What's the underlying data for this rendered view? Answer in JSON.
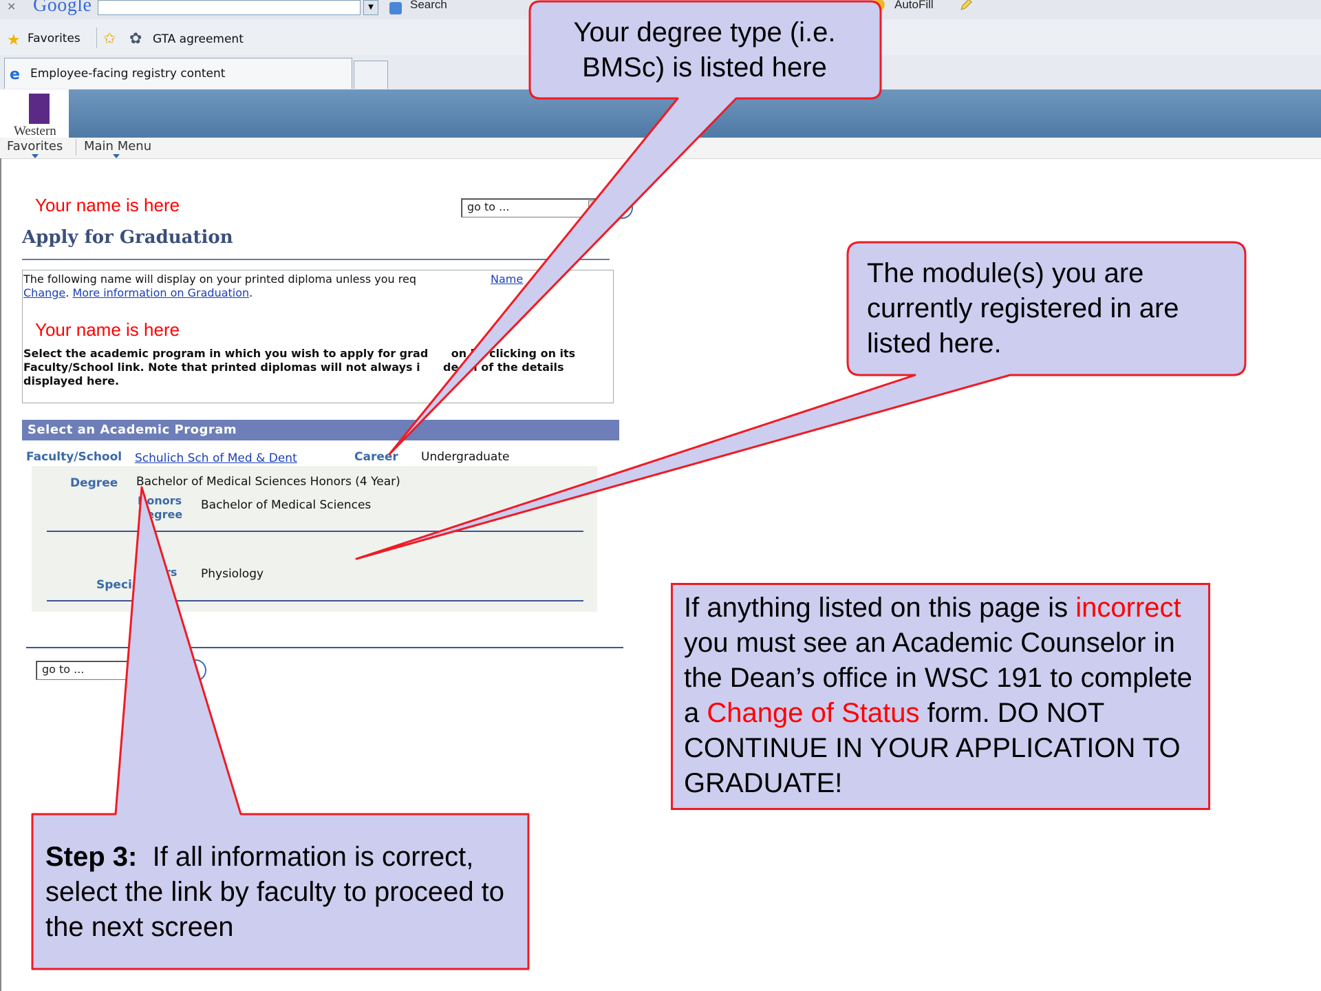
{
  "browser": {
    "google_logo": "Google",
    "search_label": "Search",
    "autofill_label": "AutoFill",
    "favorites_label": "Favorites",
    "bookmark_label": "GTA agreement",
    "tab_label": "Employee-facing registry content"
  },
  "app": {
    "logo_text": "Western",
    "nav_favorites": "Favorites",
    "nav_main_menu": "Main Menu"
  },
  "page": {
    "goto_placeholder": "go to ...",
    "title": "Apply for Graduation",
    "info_text_before": "The following name will display on your printed diploma unless you req",
    "info_link_name_change_end": "Name",
    "info_link_change": "Change",
    "info_sep": ". ",
    "info_link_more": "More information on Graduation",
    "info_period": ".",
    "instructions": "Select the academic program in which you wish to apply for grad      on by clicking on its Faculty/School link. Note that printed diplomas will not always i      de all of the details displayed here.",
    "program_header": "Select an Academic Program",
    "faculty_label": "Faculty/School",
    "faculty_link": "Schulich Sch of Med & Dent",
    "career_label": "Career",
    "career_value": "Undergraduate",
    "degree_label": "Degree",
    "degree_value": "Bachelor of Medical Sciences Honors (4 Year)",
    "honors_label_line1": "Honors",
    "honors_label_line2": "Degree",
    "honors_value": "Bachelor of Medical Sciences",
    "spec_label": "Specia",
    "spec_suffix_line1": "rs",
    "spec_suffix_line2": "n",
    "spec_value": "Physiology"
  },
  "annotations": {
    "name_note": "Your name is here",
    "callout_degree": "Your degree type (i.e. BMSc) is listed here",
    "callout_modules": "The module(s) you are currently registered in are listed here.",
    "callout_incorrect_1": "If anything listed on this page is ",
    "callout_incorrect_red1": "incorrect",
    "callout_incorrect_2": " you must see an Academic Counselor in the Dean’s office in WSC 191 to complete a ",
    "callout_incorrect_red2": "Change of Status",
    "callout_incorrect_3": " form.  DO NOT CONTINUE IN YOUR APPLICATION TO GRADUATE!",
    "step3_bold": "Step 3:",
    "step3_text": "  If all information is correct, select the link by faculty to proceed to the next screen"
  },
  "colors": {
    "callout_fill": "#cdcdef",
    "callout_border": "#ee1b24",
    "note_red": "#ff0000",
    "banner_blue": "#5b84ae",
    "program_header": "#6d7eb8"
  }
}
